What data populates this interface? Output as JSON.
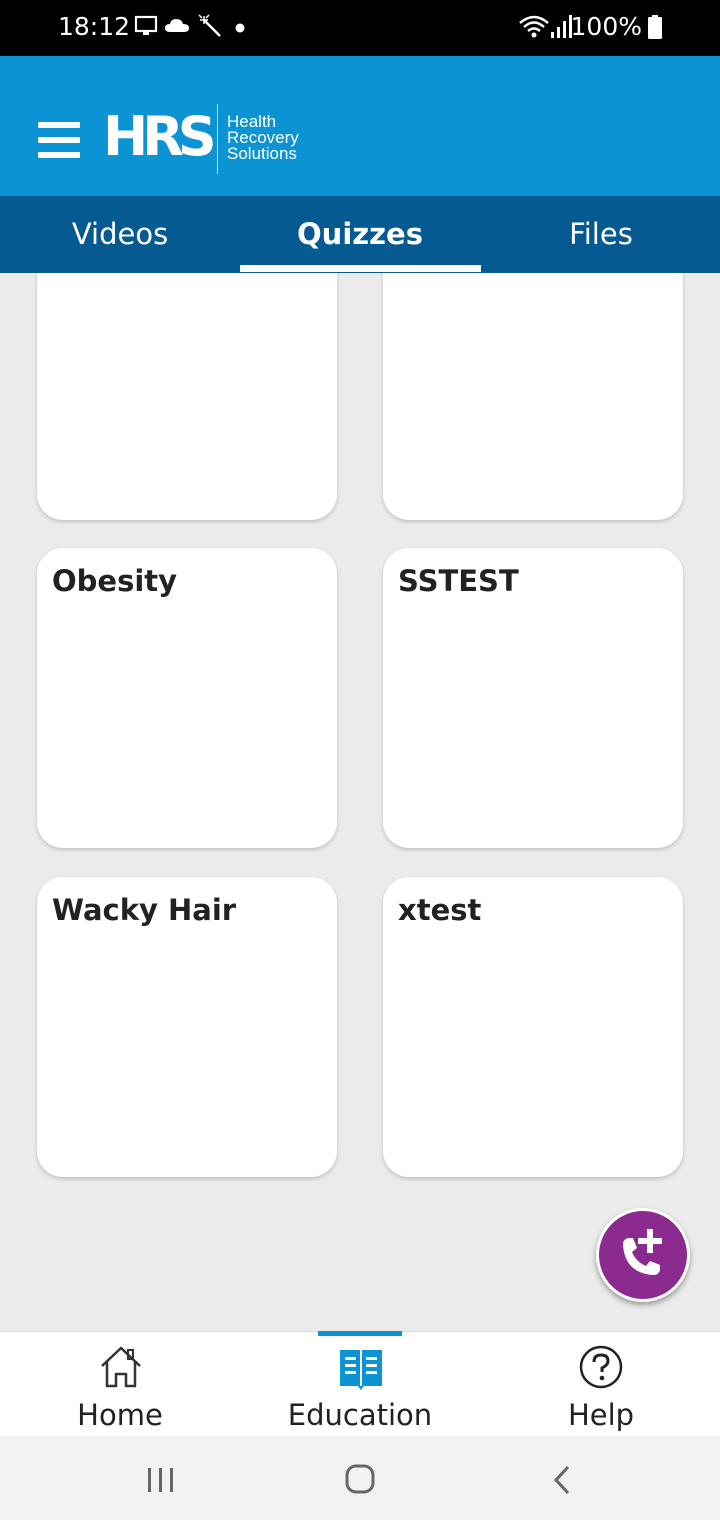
{
  "status_bar": {
    "time": "18:12",
    "battery": "100%",
    "icons": [
      "screen-icon",
      "cloud-icon",
      "magic-wand-icon",
      "dot-icon",
      "wifi-icon",
      "signal-icon",
      "battery-icon"
    ]
  },
  "header": {
    "logo_mark": "HRS",
    "logo_lines": [
      "Health",
      "Recovery",
      "Solutions"
    ]
  },
  "tabs": [
    {
      "label": "Videos",
      "active": false
    },
    {
      "label": "Quizzes",
      "active": true
    },
    {
      "label": "Files",
      "active": false
    }
  ],
  "quizzes": [
    {
      "title": ""
    },
    {
      "title": ""
    },
    {
      "title": "Obesity"
    },
    {
      "title": "SSTEST"
    },
    {
      "title": "Wacky Hair"
    },
    {
      "title": "xtest"
    }
  ],
  "fab": {
    "icon": "phone-add-icon"
  },
  "bottom_nav": [
    {
      "label": "Home",
      "icon": "home-icon",
      "active": false
    },
    {
      "label": "Education",
      "icon": "book-icon",
      "active": true
    },
    {
      "label": "Help",
      "icon": "help-icon",
      "active": false
    }
  ],
  "colors": {
    "header": "#0b93d3",
    "tab_bar": "#055a92",
    "fab": "#8b2a8f",
    "background": "#ebebeb"
  }
}
